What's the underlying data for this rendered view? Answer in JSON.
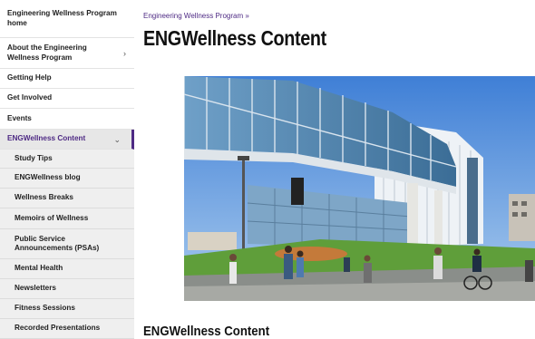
{
  "sidebar": {
    "items": [
      {
        "label": "Engineering Wellness Program home",
        "kind": "parent",
        "chevron": false
      },
      {
        "label": "About the Engineering Wellness Program",
        "kind": "parent",
        "chevron": true,
        "chevron_icon": "chevron-right-icon"
      },
      {
        "label": "Getting Help",
        "kind": "parent",
        "chevron": false
      },
      {
        "label": "Get Involved",
        "kind": "parent",
        "chevron": false
      },
      {
        "label": "Events",
        "kind": "parent",
        "chevron": false
      },
      {
        "label": "ENGWellness Content",
        "kind": "active",
        "chevron": true,
        "chevron_icon": "chevron-down-icon"
      },
      {
        "label": "Study Tips",
        "kind": "sub"
      },
      {
        "label": "ENGWellness blog",
        "kind": "sub"
      },
      {
        "label": "Wellness Breaks",
        "kind": "sub"
      },
      {
        "label": "Memoirs of Wellness",
        "kind": "sub"
      },
      {
        "label": "Public Service Announcements (PSAs)",
        "kind": "sub"
      },
      {
        "label": "Mental Health",
        "kind": "sub"
      },
      {
        "label": "Newsletters",
        "kind": "sub"
      },
      {
        "label": "Fitness Sessions",
        "kind": "sub"
      },
      {
        "label": "Recorded Presentations",
        "kind": "sub"
      }
    ]
  },
  "main": {
    "breadcrumb": "Engineering Wellness Program »",
    "title": "ENGWellness Content",
    "section_title": "ENGWellness Content"
  },
  "colors": {
    "accent": "#4e2a84",
    "sub_bg": "#efefef",
    "active_bg": "#e7e7e7"
  }
}
